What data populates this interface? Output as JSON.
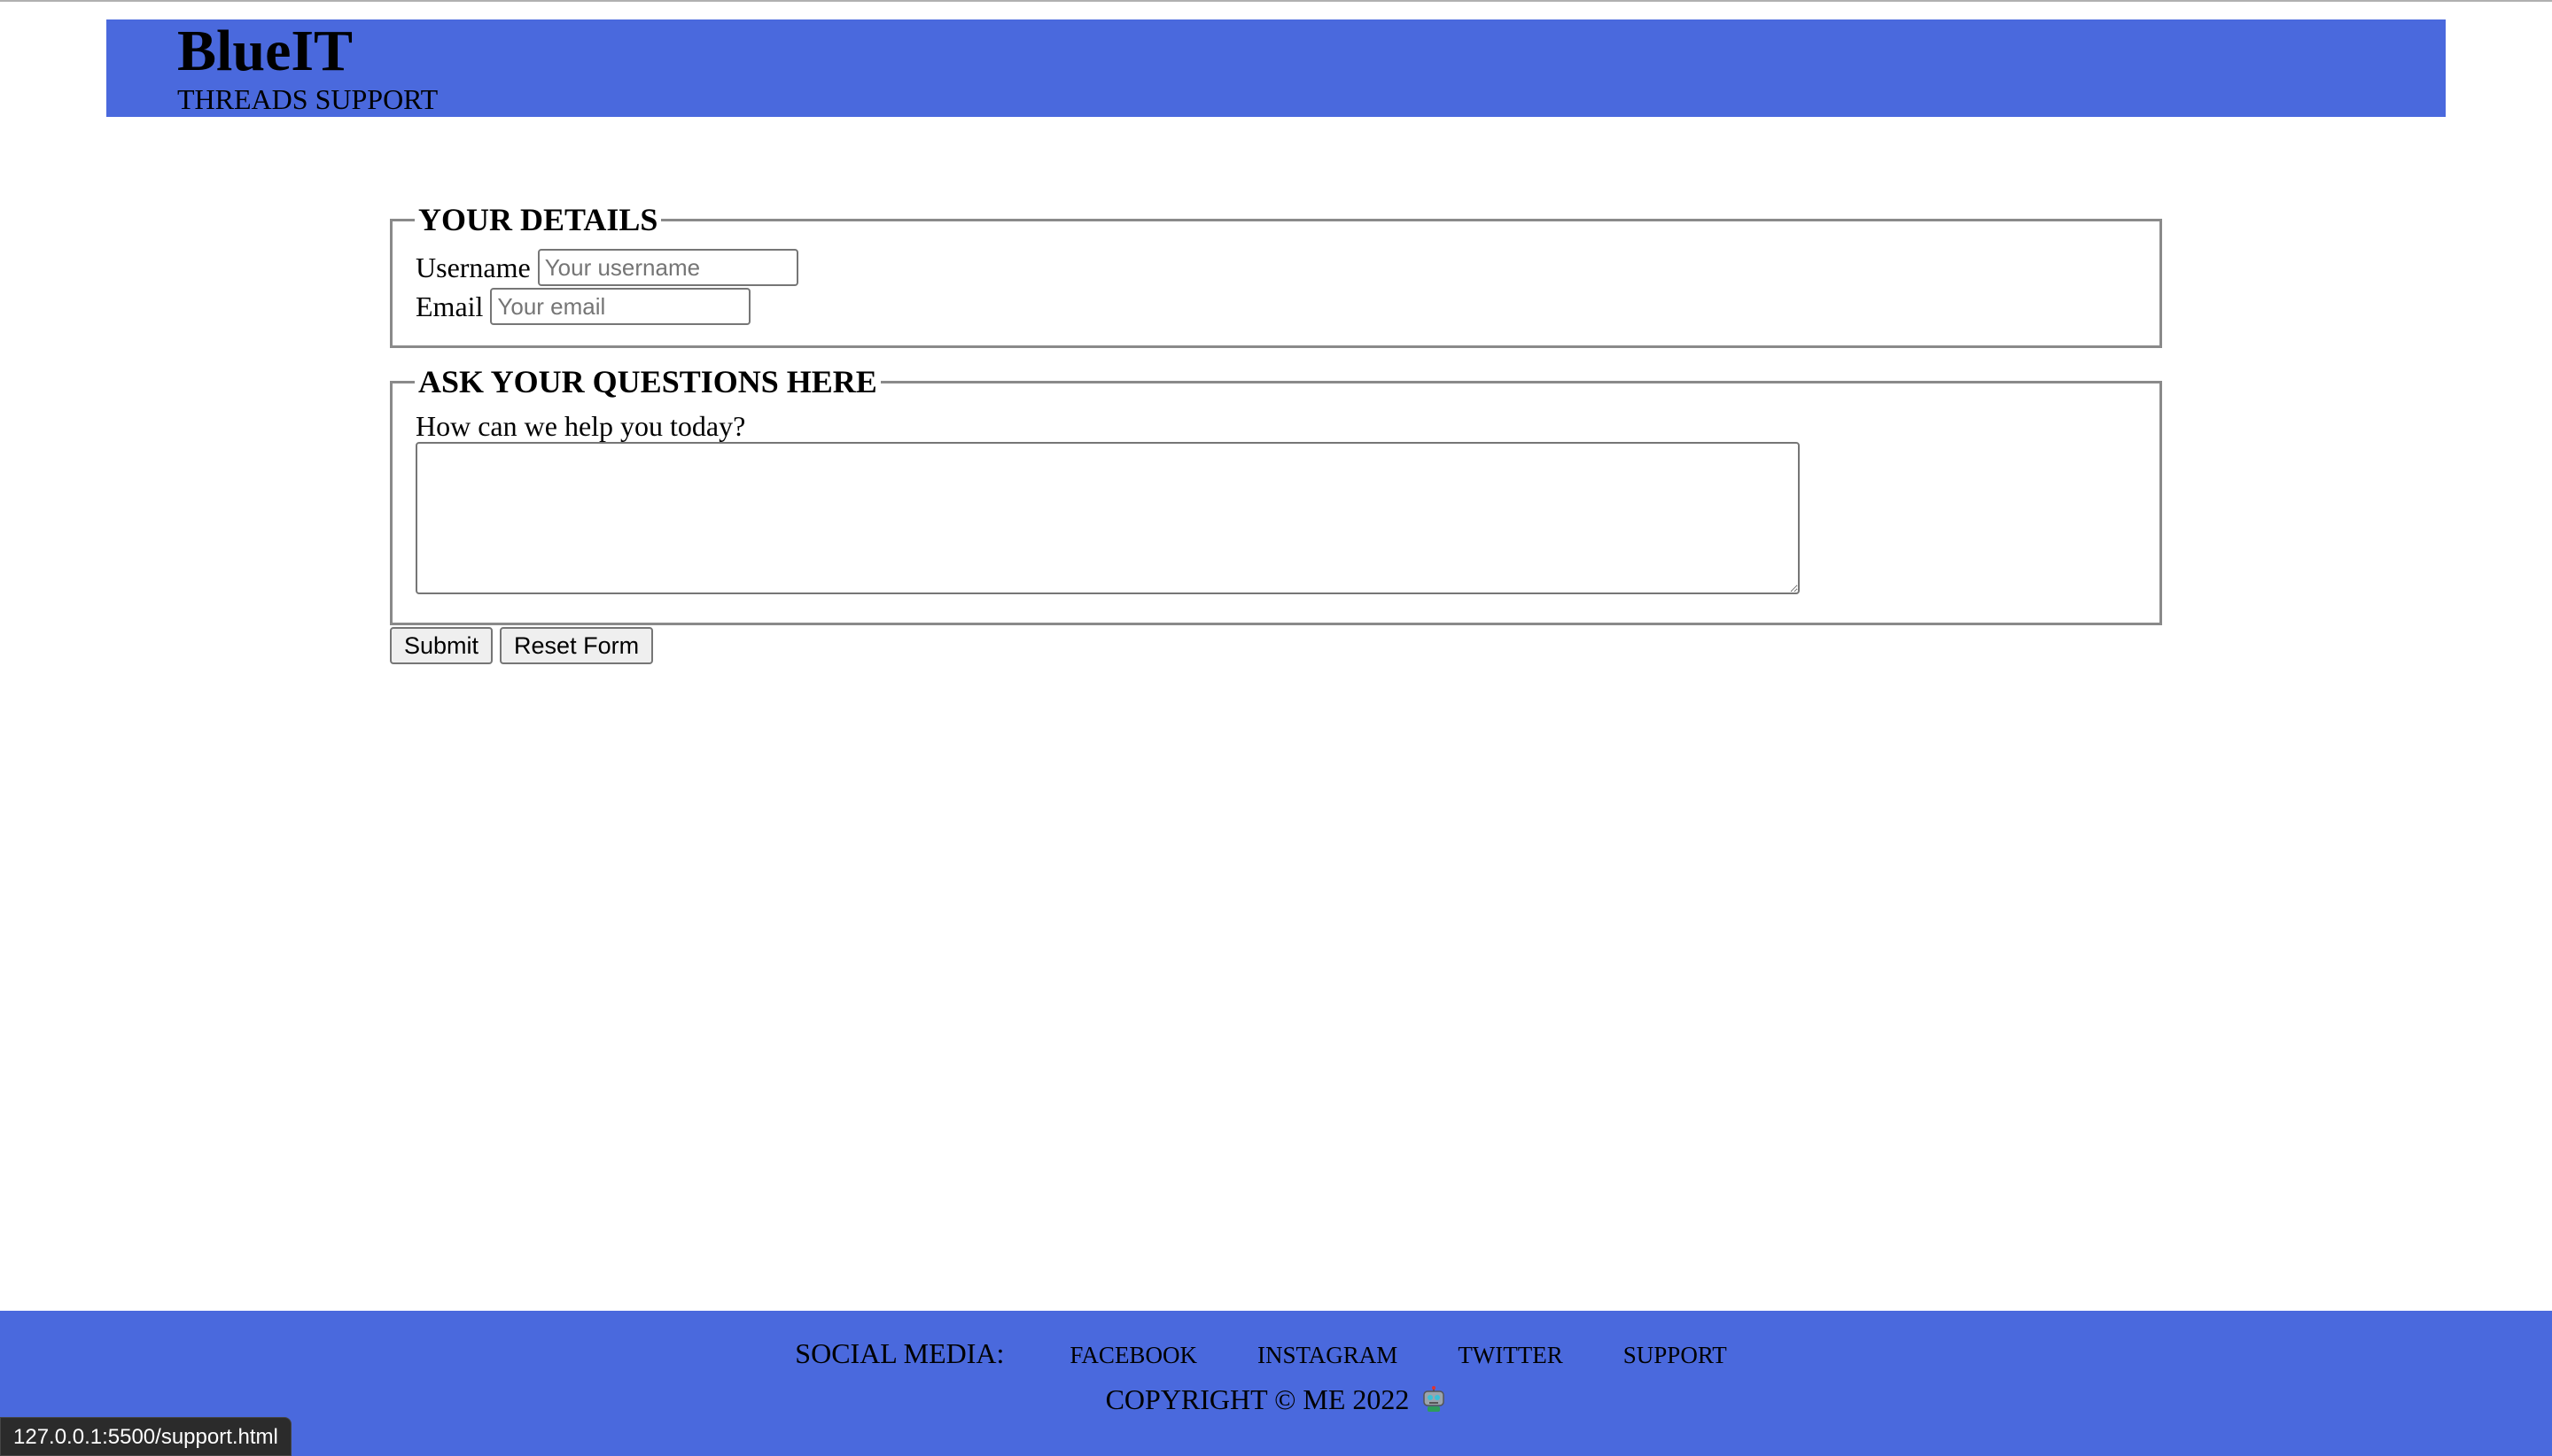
{
  "header": {
    "brand": "BlueIT",
    "tagline": "THREADS SUPPORT"
  },
  "details": {
    "legend": "YOUR DETAILS",
    "username_label": "Username",
    "username_placeholder": "Your username",
    "username_value": "",
    "email_label": "Email",
    "email_placeholder": "Your email",
    "email_value": ""
  },
  "questions": {
    "legend": "ASK YOUR QUESTIONS HERE",
    "help_label": "How can we help you today?",
    "help_value": ""
  },
  "buttons": {
    "submit": "Submit",
    "reset": "Reset Form"
  },
  "footer": {
    "social_label": "SOCIAL MEDIA:",
    "links": [
      "FACEBOOK",
      "INSTAGRAM",
      "TWITTER",
      "SUPPORT"
    ],
    "copyright": "COPYRIGHT © ME 2022",
    "icon": "robot-icon"
  },
  "status_bar": {
    "url": "127.0.0.1:5500/support.html"
  },
  "colors": {
    "header_bg": "#4a69dd",
    "footer_bg": "#4a69dd"
  }
}
